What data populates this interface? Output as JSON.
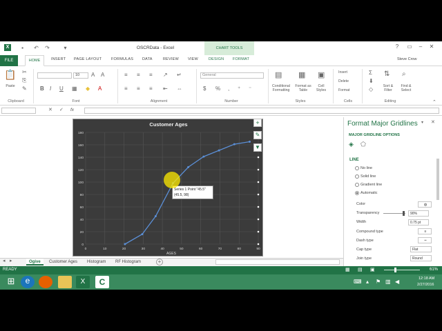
{
  "window": {
    "title": "OSCRData - Excel",
    "contextual_group": "CHART TOOLS",
    "user": "Steve Crow"
  },
  "tabs": [
    "FILE",
    "HOME",
    "INSERT",
    "PAGE LAYOUT",
    "FORMULAS",
    "DATA",
    "REVIEW",
    "VIEW",
    "DESIGN",
    "FORMAT"
  ],
  "ribbon": {
    "groups": [
      "Clipboard",
      "Font",
      "Alignment",
      "Number",
      "Styles",
      "Cells",
      "Editing"
    ],
    "paste_label": "Paste",
    "number_format_value": "General",
    "font_size_value": "10",
    "styles": [
      "Conditional Formatting",
      "Format as Table",
      "Cell Styles"
    ],
    "cells": [
      "Insert",
      "Delete",
      "Format"
    ],
    "editing": [
      "Sort & Filter",
      "Find & Select"
    ],
    "bold": "B",
    "italic": "I",
    "underline": "U",
    "currency": "$",
    "percent": "%"
  },
  "formula_bar": {
    "fx_label": "fx",
    "name_box_value": "",
    "formula_value": ""
  },
  "chart": {
    "title": "Customer Ages",
    "xlabel": "AGES",
    "tooltip_line1": "Series 1 Point \"45.5\"",
    "tooltip_line2": "(45.5, 98)"
  },
  "chart_data": {
    "type": "line",
    "title": "Customer Ages",
    "xlabel": "AGES",
    "ylabel": "",
    "xlim": [
      0,
      90
    ],
    "ylim": [
      0,
      180
    ],
    "xticks": [
      0,
      10,
      20,
      30,
      40,
      50,
      60,
      70,
      80,
      90
    ],
    "yticks": [
      0,
      20,
      40,
      60,
      80,
      100,
      120,
      140,
      160,
      180
    ],
    "grid": true,
    "series": [
      {
        "x": [
          20.5,
          29.5,
          36.5,
          45.5,
          53.5,
          61.5,
          69.5,
          77.5,
          85.5
        ],
        "y": [
          0,
          16,
          45,
          98,
          124,
          141,
          151,
          161,
          165
        ]
      }
    ],
    "colors": {
      "line": "#5b8fd6",
      "background": "#3b3b3b",
      "grid": "#555555"
    }
  },
  "sheet_tabs": [
    "Ogive",
    "Customer Ages",
    "Histogram",
    "RF Histogram"
  ],
  "active_sheet": "Ogive",
  "status": {
    "mode": "READY",
    "zoom": "61%"
  },
  "pane": {
    "title": "Format Major Gridlines",
    "subtitle": "MAJOR GRIDLINE OPTIONS",
    "section": "LINE",
    "options": [
      "No line",
      "Solid line",
      "Gradient line",
      "Automatic"
    ],
    "selected_option": "Automatic",
    "color_label": "Color",
    "transparency_label": "Transparency",
    "transparency_value": "90%",
    "width_label": "Width",
    "width_value": "0.75 pt",
    "compound_label": "Compound type",
    "dash_label": "Dash type",
    "cap_label": "Cap type",
    "cap_value": "Flat",
    "join_label": "Join type",
    "join_value": "Round"
  },
  "taskbar": {
    "time": "12:18 AM",
    "date": "2/27/2016"
  }
}
